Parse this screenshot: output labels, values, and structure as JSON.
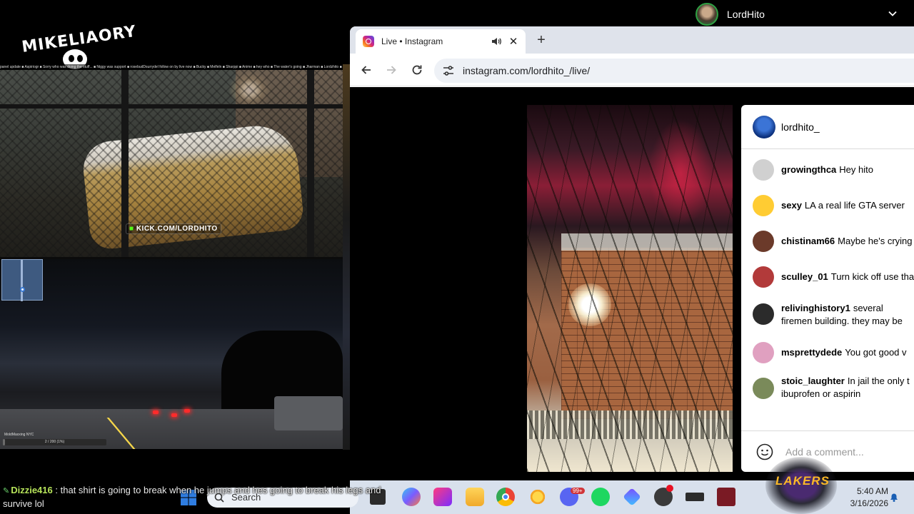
{
  "overlay": {
    "logo_text": "MIKELIAORY",
    "ticker_text": "panel update ■ Aspiriogr ■ Sorry who was doing the stuff... ■ Niggy was support ■ rosebudDsurrydel follow on by live now ■ Bucky ■ Melfeln ■ Sharppi ■ Anime ■ hey who ■ The water's going ■ Jharman ■ Lordzhito ■ https://kick.com/lordhito ■ Twitch ■ Kick.com",
    "kick_url": "KICK.COM/LORDHITO",
    "progress_label": "MoldMaxxing NYC",
    "progress_text": "2 / 200 (1%)",
    "progress_fraction": 0.01,
    "chat_user": "Dizzie416",
    "chat_separator": ":",
    "chat_message": "that shirt is going to break when he jumps and hes going to break his legs and survive lol"
  },
  "profile": {
    "name": "LordHito"
  },
  "browser": {
    "tab_title": "Live • Instagram",
    "new_tab_symbol": "+",
    "close_symbol": "✕",
    "url": "instagram.com/lordhito_/live/"
  },
  "instagram": {
    "host": "lordhito_",
    "comments": [
      {
        "user": "growingthca",
        "text": "Hey hito",
        "avatar_color": "#d0d0d0"
      },
      {
        "user": "sexy",
        "text": "LA a real life GTA server",
        "avatar_color": "#ffcc33"
      },
      {
        "user": "chistinam66",
        "text": "Maybe he's crying",
        "avatar_color": "#6b3a2a"
      },
      {
        "user": "sculley_01",
        "text": "Turn kick off use tha",
        "avatar_color": "#b23a3a"
      },
      {
        "user": "relivinghistory1",
        "text": "several firemen building. they may be talking t",
        "avatar_color": "#2b2b2b"
      },
      {
        "user": "msprettydede",
        "text": "You got good v",
        "avatar_color": "#e0a0c0"
      },
      {
        "user": "stoic_laughter",
        "text": "In jail the only t ibuprofen or aspirin",
        "avatar_color": "#7a8a5a"
      }
    ],
    "comment_placeholder": "Add a comment..."
  },
  "taskbar": {
    "search_label": "Search",
    "time": "5:40 AM",
    "date": "3/16/2026",
    "discord_badge": "99+",
    "lakers_text": "LAKERS"
  }
}
